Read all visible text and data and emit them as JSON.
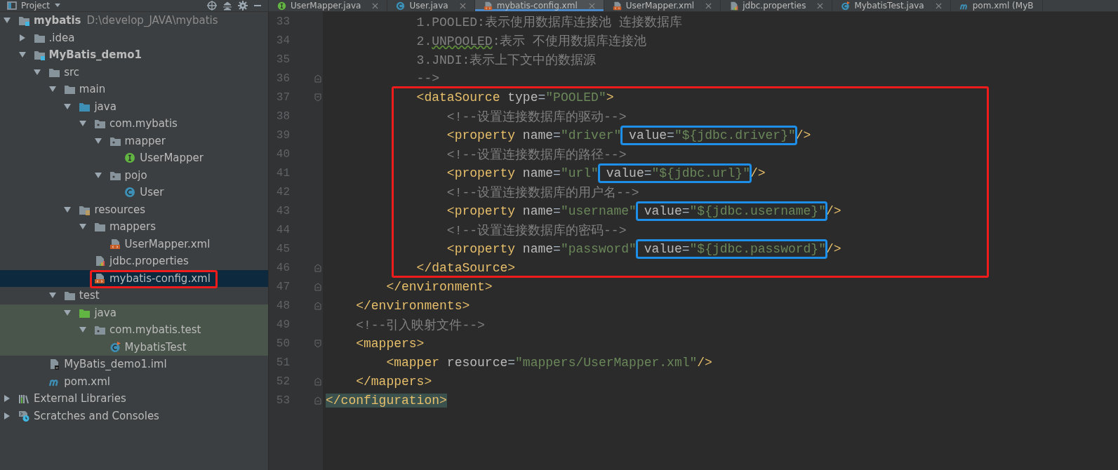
{
  "project_panel": {
    "title": "Project"
  },
  "tabs": [
    {
      "label": "UserMapper.java",
      "kind": "interface",
      "selected": false,
      "closable": true
    },
    {
      "label": "User.java",
      "kind": "class",
      "selected": false,
      "closable": true
    },
    {
      "label": "mybatis-config.xml",
      "kind": "xml",
      "selected": true,
      "closable": true
    },
    {
      "label": "UserMapper.xml",
      "kind": "xml",
      "selected": false,
      "closable": true
    },
    {
      "label": "jdbc.properties",
      "kind": "properties",
      "selected": false,
      "closable": true
    },
    {
      "label": "MybatisTest.java",
      "kind": "test-class",
      "selected": false,
      "closable": true
    },
    {
      "label": "pom.xml (MyB",
      "kind": "maven",
      "selected": false,
      "closable": false
    }
  ],
  "tree": [
    {
      "label": "mybatis",
      "path": "D:\\develop_JAVA\\mybatis",
      "kind": "module",
      "expanded": true,
      "selected": false,
      "test_scope": false,
      "outlined": false,
      "children": [
        {
          "label": ".idea",
          "kind": "folder",
          "expanded": false,
          "selected": false,
          "test_scope": false,
          "outlined": false
        },
        {
          "label": "MyBatis_demo1",
          "kind": "module",
          "expanded": true,
          "selected": false,
          "test_scope": false,
          "outlined": false,
          "children": [
            {
              "label": "src",
              "kind": "folder",
              "expanded": true,
              "selected": false,
              "test_scope": false,
              "outlined": false,
              "children": [
                {
                  "label": "main",
                  "kind": "folder",
                  "expanded": true,
                  "selected": false,
                  "test_scope": false,
                  "outlined": false,
                  "children": [
                    {
                      "label": "java",
                      "kind": "source-folder",
                      "expanded": true,
                      "selected": false,
                      "test_scope": false,
                      "outlined": false,
                      "children": [
                        {
                          "label": "com.mybatis",
                          "kind": "package",
                          "expanded": true,
                          "selected": false,
                          "test_scope": false,
                          "outlined": false,
                          "children": [
                            {
                              "label": "mapper",
                              "kind": "package",
                              "expanded": true,
                              "selected": false,
                              "test_scope": false,
                              "outlined": false,
                              "children": [
                                {
                                  "label": "UserMapper",
                                  "kind": "interface",
                                  "selected": false,
                                  "test_scope": false,
                                  "outlined": false
                                }
                              ]
                            },
                            {
                              "label": "pojo",
                              "kind": "package",
                              "expanded": true,
                              "selected": false,
                              "test_scope": false,
                              "outlined": false,
                              "children": [
                                {
                                  "label": "User",
                                  "kind": "class",
                                  "selected": false,
                                  "test_scope": false,
                                  "outlined": false
                                }
                              ]
                            }
                          ]
                        }
                      ]
                    },
                    {
                      "label": "resources",
                      "kind": "resources-folder",
                      "expanded": true,
                      "selected": false,
                      "test_scope": false,
                      "outlined": false,
                      "children": [
                        {
                          "label": "mappers",
                          "kind": "folder",
                          "expanded": true,
                          "selected": false,
                          "test_scope": false,
                          "outlined": false,
                          "children": [
                            {
                              "label": "UserMapper.xml",
                              "kind": "xml",
                              "selected": false,
                              "test_scope": false,
                              "outlined": false
                            }
                          ]
                        },
                        {
                          "label": "jdbc.properties",
                          "kind": "properties",
                          "selected": false,
                          "test_scope": false,
                          "outlined": false
                        },
                        {
                          "label": "mybatis-config.xml",
                          "kind": "xml",
                          "selected": true,
                          "test_scope": false,
                          "outlined": true
                        }
                      ]
                    }
                  ]
                },
                {
                  "label": "test",
                  "kind": "folder",
                  "expanded": true,
                  "selected": false,
                  "test_scope": false,
                  "outlined": false,
                  "children": [
                    {
                      "label": "java",
                      "kind": "test-folder",
                      "expanded": true,
                      "selected": false,
                      "test_scope": true,
                      "outlined": false,
                      "children": [
                        {
                          "label": "com.mybatis.test",
                          "kind": "package",
                          "expanded": true,
                          "selected": false,
                          "test_scope": true,
                          "outlined": false,
                          "children": [
                            {
                              "label": "MybatisTest",
                              "kind": "test-class",
                              "selected": false,
                              "test_scope": true,
                              "outlined": false
                            }
                          ]
                        }
                      ]
                    }
                  ]
                }
              ]
            },
            {
              "label": "MyBatis_demo1.iml",
              "kind": "iml",
              "selected": false,
              "test_scope": false,
              "outlined": false
            },
            {
              "label": "pom.xml",
              "kind": "maven",
              "selected": false,
              "test_scope": false,
              "outlined": false
            }
          ]
        }
      ]
    },
    {
      "label": "External Libraries",
      "kind": "libraries",
      "expanded": false,
      "selected": false,
      "test_scope": false,
      "outlined": false
    },
    {
      "label": "Scratches and Consoles",
      "kind": "scratches",
      "expanded": false,
      "selected": false,
      "test_scope": false,
      "outlined": false
    }
  ],
  "editor": {
    "blocks": [
      {
        "outlined": false,
        "lines": [
          {
            "number": "33",
            "kind": "plain",
            "tokens": [
              {
                "kind": "comment",
                "text": "            1.POOLED:表示使用数据库连接池 连接数据库"
              }
            ]
          },
          {
            "number": "34",
            "kind": "plain",
            "tokens": [
              {
                "kind": "comment",
                "text": "            2."
              },
              {
                "kind": "typo",
                "text": "UNPOOLED"
              },
              {
                "kind": "comment",
                "text": ":表示 不使用数据库连接池"
              }
            ]
          },
          {
            "number": "35",
            "kind": "plain",
            "tokens": [
              {
                "kind": "comment",
                "text": "            3.JNDI:表示上下文中的数据源"
              }
            ]
          },
          {
            "number": "36",
            "kind": "fold-end",
            "tokens": [
              {
                "kind": "comment",
                "text": "            -->"
              }
            ]
          }
        ]
      },
      {
        "outlined": true,
        "lines": [
          {
            "number": "37",
            "kind": "fold-start",
            "tokens": [
              {
                "kind": "tag",
                "text": "            <dataSource"
              },
              {
                "kind": "attr",
                "text": " type"
              },
              {
                "kind": "plain",
                "text": "="
              },
              {
                "kind": "value",
                "text": "\"POOLED\""
              },
              {
                "kind": "tag",
                "text": ">"
              }
            ]
          },
          {
            "number": "38",
            "kind": "plain",
            "tokens": [
              {
                "kind": "comment",
                "text": "                <!--设置连接数据库的驱动-->"
              }
            ]
          },
          {
            "number": "39",
            "kind": "plain",
            "tokens": [
              {
                "kind": "tag",
                "text": "                <property"
              },
              {
                "kind": "attr",
                "text": " name"
              },
              {
                "kind": "plain",
                "text": "="
              },
              {
                "kind": "value",
                "text": "\"driver\""
              },
              {
                "kind": "group",
                "outlined": true,
                "tokens": [
                  {
                    "kind": "attr",
                    "text": " value"
                  },
                  {
                    "kind": "plain",
                    "text": "="
                  },
                  {
                    "kind": "value",
                    "text": "\"${jdbc.driver}\""
                  }
                ]
              },
              {
                "kind": "tag",
                "text": "/>"
              }
            ]
          },
          {
            "number": "40",
            "kind": "plain",
            "tokens": [
              {
                "kind": "comment",
                "text": "                <!--设置连接数据库的路径-->"
              }
            ]
          },
          {
            "number": "41",
            "kind": "plain",
            "tokens": [
              {
                "kind": "tag",
                "text": "                <property"
              },
              {
                "kind": "attr",
                "text": " name"
              },
              {
                "kind": "plain",
                "text": "="
              },
              {
                "kind": "value",
                "text": "\"url\""
              },
              {
                "kind": "group",
                "outlined": true,
                "tokens": [
                  {
                    "kind": "attr",
                    "text": " value"
                  },
                  {
                    "kind": "plain",
                    "text": "="
                  },
                  {
                    "kind": "value",
                    "text": "\"${jdbc.url}\""
                  }
                ]
              },
              {
                "kind": "tag",
                "text": "/>"
              }
            ]
          },
          {
            "number": "42",
            "kind": "plain",
            "tokens": [
              {
                "kind": "comment",
                "text": "                <!--设置连接数据库的用户名-->"
              }
            ]
          },
          {
            "number": "43",
            "kind": "plain",
            "tokens": [
              {
                "kind": "tag",
                "text": "                <property"
              },
              {
                "kind": "attr",
                "text": " name"
              },
              {
                "kind": "plain",
                "text": "="
              },
              {
                "kind": "value",
                "text": "\"username\""
              },
              {
                "kind": "group",
                "outlined": true,
                "tokens": [
                  {
                    "kind": "attr",
                    "text": " value"
                  },
                  {
                    "kind": "plain",
                    "text": "="
                  },
                  {
                    "kind": "value",
                    "text": "\"${jdbc.username}\""
                  }
                ]
              },
              {
                "kind": "tag",
                "text": "/>"
              }
            ]
          },
          {
            "number": "44",
            "kind": "plain",
            "tokens": [
              {
                "kind": "comment",
                "text": "                <!--设置连接数据库的密码-->"
              }
            ]
          },
          {
            "number": "45",
            "kind": "plain",
            "tokens": [
              {
                "kind": "tag",
                "text": "                <property"
              },
              {
                "kind": "attr",
                "text": " name"
              },
              {
                "kind": "plain",
                "text": "="
              },
              {
                "kind": "value",
                "text": "\"password\""
              },
              {
                "kind": "group",
                "outlined": true,
                "tokens": [
                  {
                    "kind": "attr",
                    "text": " value"
                  },
                  {
                    "kind": "plain",
                    "text": "="
                  },
                  {
                    "kind": "value",
                    "text": "\"${jdbc.password}\""
                  }
                ]
              },
              {
                "kind": "tag",
                "text": "/>"
              }
            ]
          },
          {
            "number": "46",
            "kind": "fold-end",
            "tokens": [
              {
                "kind": "tag",
                "text": "            </dataSource>"
              }
            ]
          }
        ]
      },
      {
        "outlined": false,
        "lines": [
          {
            "number": "47",
            "kind": "fold-end",
            "tokens": [
              {
                "kind": "tag",
                "text": "        </environment>"
              }
            ]
          },
          {
            "number": "48",
            "kind": "fold-end",
            "tokens": [
              {
                "kind": "tag",
                "text": "    </environments>"
              }
            ]
          },
          {
            "number": "49",
            "kind": "plain",
            "tokens": [
              {
                "kind": "comment",
                "text": "    <!--引入映射文件-->"
              }
            ]
          },
          {
            "number": "50",
            "kind": "fold-start",
            "tokens": [
              {
                "kind": "tag",
                "text": "    <mappers>"
              }
            ]
          },
          {
            "number": "51",
            "kind": "plain",
            "tokens": [
              {
                "kind": "tag",
                "text": "        <mapper"
              },
              {
                "kind": "attr",
                "text": " resource"
              },
              {
                "kind": "plain",
                "text": "="
              },
              {
                "kind": "value",
                "text": "\"mappers/UserMapper.xml\""
              },
              {
                "kind": "tag",
                "text": "/>"
              }
            ]
          },
          {
            "number": "52",
            "kind": "fold-end",
            "tokens": [
              {
                "kind": "tag",
                "text": "    </mappers>"
              }
            ]
          },
          {
            "number": "53",
            "kind": "fold-end",
            "tokens": [
              {
                "kind": "tag",
                "text": "</configuration>",
                "match_highlight": true
              }
            ]
          }
        ]
      }
    ]
  }
}
